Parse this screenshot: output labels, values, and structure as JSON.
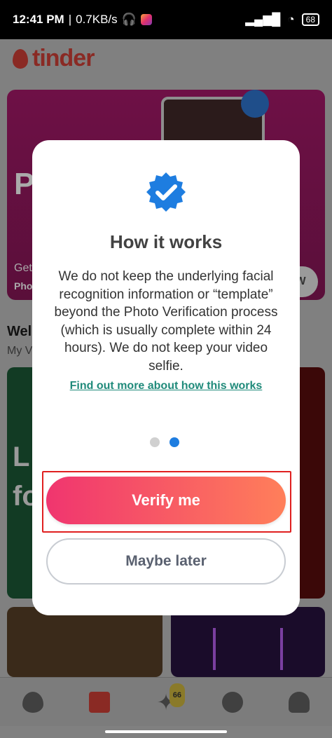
{
  "status_bar": {
    "time": "12:41 PM",
    "separator": "|",
    "speed": "0.7KB/s",
    "battery": "68"
  },
  "app": {
    "logo_text": "tinder",
    "top_card": {
      "big_letter": "P",
      "get_text": "Get",
      "photo_text": "Pho",
      "pill_text": "W"
    },
    "welcome_text": "Wel",
    "my_text": "My V",
    "mid_card_text_1": "L",
    "mid_card_text_2": "fo",
    "likes_count": "66"
  },
  "modal": {
    "title": "How it works",
    "description": "We do not keep the underlying facial recognition information or “template” beyond the Photo Verification process (which is usually complete within 24 hours). We do not keep your video selfie.",
    "link_text": "Find out more about how this works",
    "pagination": {
      "total": 2,
      "active_index": 1
    },
    "primary_button": "Verify me",
    "secondary_button": "Maybe later"
  },
  "colors": {
    "primary_gradient_start": "#f0356f",
    "primary_gradient_end": "#ff7f5a",
    "link": "#1f8a7a",
    "verified_badge": "#1e7de0",
    "highlight_box": "#e02020"
  }
}
